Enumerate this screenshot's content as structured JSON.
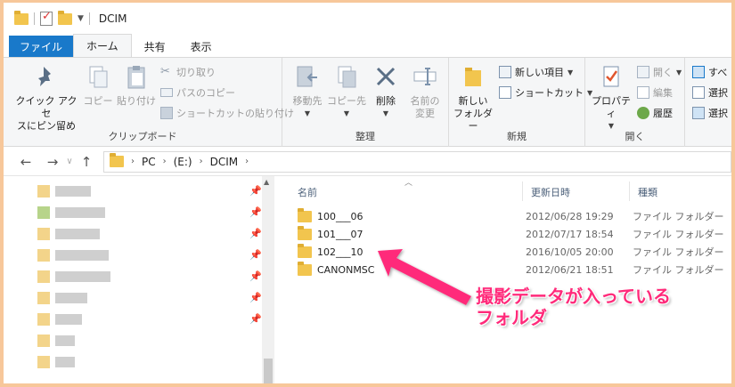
{
  "window": {
    "title": "DCIM"
  },
  "tabs": [
    {
      "label": "ファイル"
    },
    {
      "label": "ホーム"
    },
    {
      "label": "共有"
    },
    {
      "label": "表示"
    }
  ],
  "ribbon": {
    "clipboard": {
      "pin_label_1": "クイック アクセ",
      "pin_label_2": "スにピン留め",
      "copy_label": "コピー",
      "paste_label": "貼り付け",
      "cut_label": "切り取り",
      "copy_path_label": "パスのコピー",
      "paste_shortcut_label": "ショートカットの貼り付け",
      "group_label": "クリップボード"
    },
    "organize": {
      "move_to_label_1": "移動先",
      "copy_to_label_1": "コピー先",
      "delete_label_1": "削除",
      "rename_label_1": "名前の",
      "rename_label_2": "変更",
      "group_label": "整理"
    },
    "new": {
      "new_folder_label_1": "新しい",
      "new_folder_label_2": "フォルダー",
      "new_item_label": "新しい項目",
      "easy_access_label": "ショートカット",
      "group_label": "新規"
    },
    "open": {
      "properties_label": "プロパティ",
      "open_label": "開く",
      "edit_label": "編集",
      "history_label": "履歴",
      "group_label": "開く"
    },
    "select": {
      "select_all_label": "すべ",
      "select_none_label": "選択",
      "invert_label": "選択"
    }
  },
  "address": {
    "crumbs": [
      "PC",
      "(E:)",
      "DCIM"
    ]
  },
  "filelist": {
    "columns": {
      "name": "名前",
      "date": "更新日時",
      "type": "種類"
    },
    "rows": [
      {
        "name": "100___06",
        "date": "2012/06/28 19:29",
        "type": "ファイル フォルダー"
      },
      {
        "name": "101___07",
        "date": "2012/07/17 18:54",
        "type": "ファイル フォルダー"
      },
      {
        "name": "102___10",
        "date": "2016/10/05 20:00",
        "type": "ファイル フォルダー"
      },
      {
        "name": "CANONMSC",
        "date": "2012/06/21 18:51",
        "type": "ファイル フォルダー"
      }
    ]
  },
  "annotation": {
    "line1": "撮影データが入っている",
    "line2": "フォルダ"
  },
  "colors": {
    "accent": "#1979ca",
    "annotation": "#ff2a7a",
    "folder": "#f2c54e"
  }
}
